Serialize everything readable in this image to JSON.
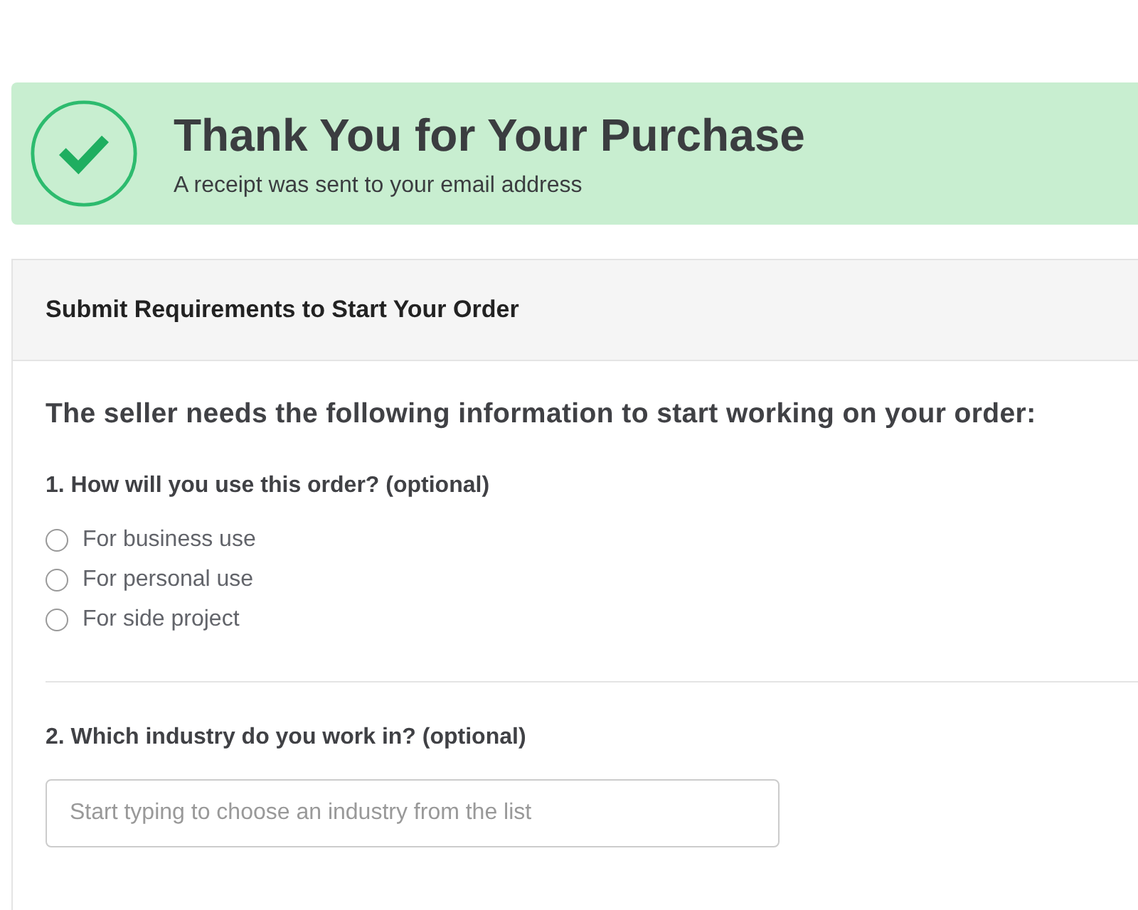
{
  "banner": {
    "title": "Thank You for Your Purchase",
    "subtitle": "A receipt was sent to your email address"
  },
  "card": {
    "title": "Submit Requirements to Start Your Order",
    "intro": "The seller needs the following information to start working on your order:",
    "questions": [
      {
        "kind": "radio",
        "label": "1. How will you use this order? (optional)",
        "options": [
          {
            "label": "For business use",
            "selected": false
          },
          {
            "label": "For personal use",
            "selected": false
          },
          {
            "label": "For side project",
            "selected": false
          }
        ]
      },
      {
        "kind": "text",
        "label": "2. Which industry do you work in? (optional)",
        "placeholder": "Start typing to choose an industry from the list"
      }
    ]
  }
}
